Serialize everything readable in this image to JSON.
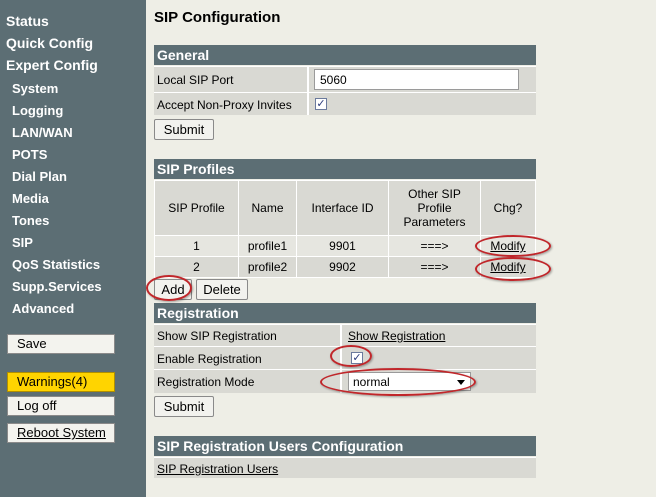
{
  "sidebar": {
    "main_items": [
      "Status",
      "Quick Config",
      "Expert Config"
    ],
    "sub_items": [
      "System",
      "Logging",
      "LAN/WAN",
      "POTS",
      "Dial Plan",
      "Media",
      "Tones",
      "SIP",
      "QoS Statistics",
      "Supp.Services",
      "Advanced"
    ],
    "save_label": "Save",
    "warnings_label": "Warnings(4)",
    "logoff_label": "Log off",
    "reboot_label": "Reboot System"
  },
  "page_title": "SIP Configuration",
  "general": {
    "heading": "General",
    "local_port_label": "Local SIP Port",
    "local_port_value": "5060",
    "accept_invites_label": "Accept Non-Proxy Invites",
    "accept_invites_checked": true,
    "submit_label": "Submit"
  },
  "profiles": {
    "heading": "SIP Profiles",
    "columns": [
      "SIP Profile",
      "Name",
      "Interface ID",
      "Other SIP Profile Parameters",
      "Chg?"
    ],
    "rows": [
      {
        "profile": "1",
        "name": "profile1",
        "interface_id": "9901",
        "params": "===>",
        "chg": "Modify"
      },
      {
        "profile": "2",
        "name": "profile2",
        "interface_id": "9902",
        "params": "===>",
        "chg": "Modify"
      }
    ],
    "add_label": "Add",
    "delete_label": "Delete"
  },
  "registration": {
    "heading": "Registration",
    "show_label": "Show SIP Registration",
    "show_link": "Show Registration",
    "enable_label": "Enable Registration",
    "enable_checked": true,
    "mode_label": "Registration Mode",
    "mode_value": "normal",
    "submit_label": "Submit"
  },
  "users": {
    "heading": "SIP Registration Users Configuration",
    "link": "SIP Registration Users"
  },
  "colors": {
    "sidebar_bg": "#5c6e74",
    "content_bg": "#eeeee6",
    "warning": "#ffd400",
    "annotation": "#c0262a"
  }
}
